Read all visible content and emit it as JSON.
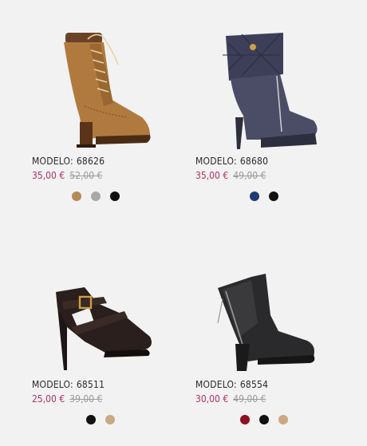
{
  "products": [
    {
      "model_label": "MODELO:",
      "model_number": "68626",
      "price_now": "35,00 €",
      "price_old": "52,00 €",
      "image_icon": "lace-up-heeled-boot-icon",
      "swatches": [
        {
          "name": "tan",
          "color": "#b58a57"
        },
        {
          "name": "grey",
          "color": "#a8a8aa"
        },
        {
          "name": "black",
          "color": "#111111"
        }
      ]
    },
    {
      "model_label": "MODELO:",
      "model_number": "68680",
      "price_now": "35,00 €",
      "price_old": "49,00 €",
      "image_icon": "quilted-platform-bootie-icon",
      "swatches": [
        {
          "name": "navy",
          "color": "#1f3d73"
        },
        {
          "name": "black",
          "color": "#111111"
        }
      ]
    },
    {
      "model_label": "MODELO:",
      "model_number": "68511",
      "price_now": "25,00 €",
      "price_old": "39,00 €",
      "image_icon": "buckle-strap-stiletto-bootie-icon",
      "swatches": [
        {
          "name": "black",
          "color": "#111111"
        },
        {
          "name": "beige",
          "color": "#c9a982"
        }
      ]
    },
    {
      "model_label": "MODELO:",
      "model_number": "68554",
      "price_now": "30,00 €",
      "price_old": "49,00 €",
      "image_icon": "zip-ankle-boot-icon",
      "swatches": [
        {
          "name": "burgundy",
          "color": "#8e1020"
        },
        {
          "name": "black",
          "color": "#111111"
        },
        {
          "name": "beige",
          "color": "#c9a982"
        }
      ]
    }
  ]
}
